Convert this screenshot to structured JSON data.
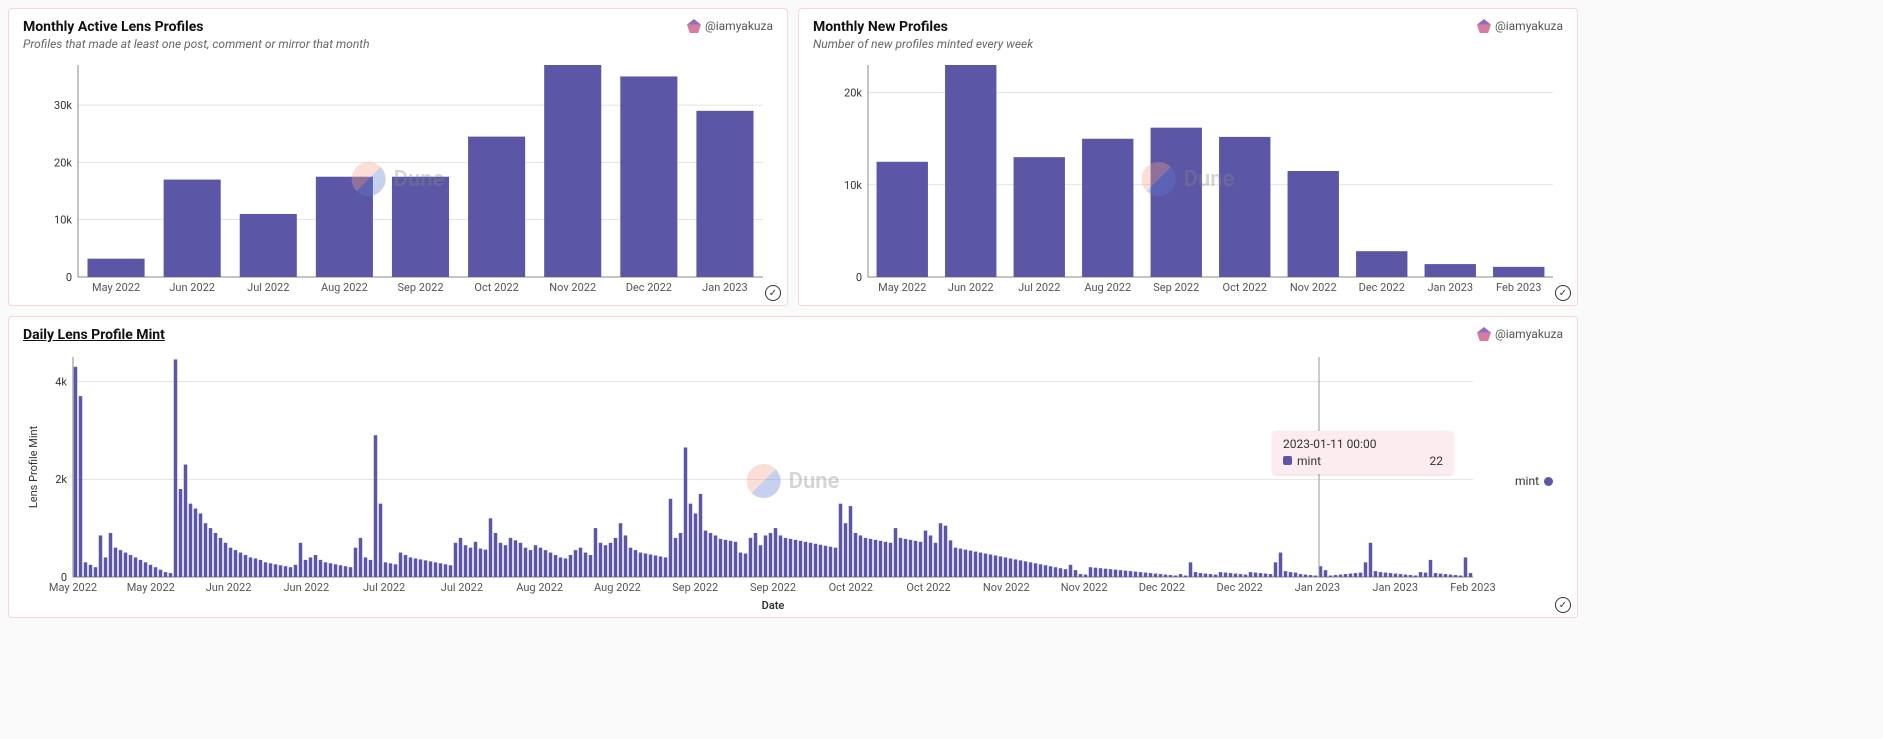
{
  "watermark": "Dune",
  "author_handle": "@iamyakuza",
  "panels": {
    "active": {
      "title": "Monthly Active Lens Profiles",
      "subtitle": "Profiles that made at least one post, comment or mirror that month"
    },
    "new": {
      "title": "Monthly New Profiles",
      "subtitle": "Number of new profiles minted every week"
    },
    "daily": {
      "title": "Daily Lens Profile Mint",
      "ylabel": "Lens Profile Mint",
      "xlabel": "Date",
      "legend": "mint",
      "tooltip": {
        "date": "2023-01-11 00:00",
        "series": "mint",
        "value": "22"
      }
    }
  },
  "chart_data": [
    {
      "id": "active",
      "type": "bar",
      "title": "Monthly Active Lens Profiles",
      "categories": [
        "May 2022",
        "Jun 2022",
        "Jul 2022",
        "Aug 2022",
        "Sep 2022",
        "Oct 2022",
        "Nov 2022",
        "Dec 2022",
        "Jan 2023"
      ],
      "values": [
        3200,
        17000,
        11000,
        17500,
        17500,
        24500,
        37000,
        35000,
        29000
      ],
      "ylim": [
        0,
        37000
      ],
      "yticks": [
        0,
        10000,
        20000,
        30000
      ],
      "ytick_labels": [
        "0",
        "10k",
        "20k",
        "30k"
      ],
      "xlabel": "",
      "ylabel": ""
    },
    {
      "id": "new",
      "type": "bar",
      "title": "Monthly New Profiles",
      "categories": [
        "May 2022",
        "Jun 2022",
        "Jul 2022",
        "Aug 2022",
        "Sep 2022",
        "Oct 2022",
        "Nov 2022",
        "Dec 2022",
        "Jan 2023",
        "Feb 2023"
      ],
      "values": [
        12500,
        23000,
        13000,
        15000,
        16200,
        15200,
        11500,
        2800,
        1400,
        1100
      ],
      "ylim": [
        0,
        23000
      ],
      "yticks": [
        0,
        10000,
        20000
      ],
      "ytick_labels": [
        "0",
        "10k",
        "20k"
      ],
      "xlabel": "",
      "ylabel": ""
    },
    {
      "id": "daily",
      "type": "bar",
      "title": "Daily Lens Profile Mint",
      "xlabel": "Date",
      "ylabel": "Lens Profile Mint",
      "ylim": [
        0,
        4500
      ],
      "yticks": [
        0,
        2000,
        4000
      ],
      "ytick_labels": [
        "0",
        "2k",
        "4k"
      ],
      "xticks": [
        "May 2022",
        "May 2022",
        "Jun 2022",
        "Jun 2022",
        "Jul 2022",
        "Jul 2022",
        "Aug 2022",
        "Aug 2022",
        "Sep 2022",
        "Sep 2022",
        "Oct 2022",
        "Oct 2022",
        "Nov 2022",
        "Nov 2022",
        "Dec 2022",
        "Dec 2022",
        "Jan 2023",
        "Jan 2023",
        "Feb 2023"
      ],
      "legend": [
        "mint"
      ],
      "tooltip_sample": {
        "x": "2023-01-11 00:00",
        "series": "mint",
        "value": 22
      },
      "values": [
        4300,
        3700,
        300,
        250,
        200,
        850,
        400,
        900,
        600,
        550,
        500,
        450,
        400,
        350,
        300,
        250,
        200,
        150,
        100,
        80,
        4450,
        1800,
        2300,
        1500,
        1400,
        1300,
        1100,
        1000,
        900,
        800,
        700,
        600,
        550,
        500,
        450,
        400,
        380,
        350,
        300,
        280,
        260,
        240,
        220,
        200,
        250,
        700,
        350,
        400,
        450,
        350,
        300,
        280,
        260,
        240,
        220,
        200,
        600,
        800,
        400,
        350,
        2900,
        1500,
        300,
        280,
        260,
        500,
        450,
        400,
        380,
        360,
        340,
        320,
        300,
        280,
        260,
        240,
        700,
        800,
        650,
        600,
        720,
        580,
        560,
        1200,
        900,
        700,
        650,
        800,
        750,
        700,
        600,
        550,
        650,
        600,
        550,
        500,
        450,
        400,
        380,
        450,
        550,
        600,
        500,
        450,
        1000,
        700,
        650,
        700,
        800,
        1100,
        850,
        600,
        550,
        500,
        480,
        460,
        440,
        420,
        400,
        1600,
        800,
        900,
        2650,
        1500,
        1300,
        1700,
        950,
        900,
        850,
        780,
        760,
        740,
        720,
        500,
        480,
        800,
        900,
        650,
        850,
        900,
        1000,
        850,
        800,
        780,
        760,
        740,
        720,
        700,
        680,
        660,
        640,
        620,
        600,
        1500,
        1100,
        1450,
        900,
        850,
        800,
        780,
        760,
        740,
        720,
        700,
        1000,
        800,
        780,
        760,
        740,
        720,
        950,
        850,
        700,
        1100,
        1050,
        750,
        600,
        580,
        560,
        540,
        520,
        500,
        480,
        460,
        440,
        420,
        400,
        380,
        360,
        340,
        320,
        300,
        280,
        260,
        240,
        220,
        200,
        180,
        160,
        250,
        140,
        60,
        50,
        200,
        190,
        180,
        170,
        160,
        150,
        140,
        130,
        120,
        110,
        100,
        90,
        80,
        70,
        60,
        50,
        40,
        30,
        60,
        30,
        300,
        100,
        80,
        70,
        60,
        50,
        100,
        90,
        80,
        70,
        60,
        50,
        100,
        90,
        80,
        70,
        60,
        300,
        500,
        120,
        100,
        90,
        60,
        50,
        40,
        30,
        220,
        140,
        30,
        40,
        50,
        60,
        70,
        80,
        90,
        300,
        700,
        120,
        100,
        90,
        80,
        70,
        60,
        50,
        40,
        30,
        100,
        90,
        350,
        80,
        70,
        60,
        50,
        40,
        30,
        400,
        80
      ]
    }
  ]
}
